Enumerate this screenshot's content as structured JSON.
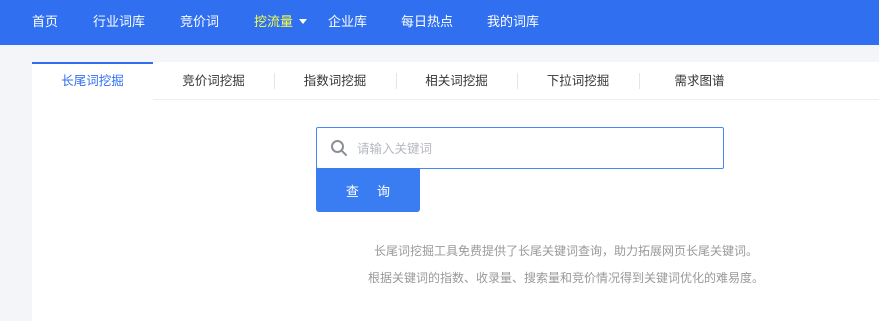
{
  "topnav": {
    "items": [
      {
        "label": "首页"
      },
      {
        "label": "行业词库"
      },
      {
        "label": "竞价词"
      },
      {
        "label": "挖流量"
      },
      {
        "label": "企业库"
      },
      {
        "label": "每日热点"
      },
      {
        "label": "我的词库"
      }
    ],
    "active_index": 3
  },
  "tabs": [
    {
      "label": "长尾词挖掘"
    },
    {
      "label": "竞价词挖掘"
    },
    {
      "label": "指数词挖掘"
    },
    {
      "label": "相关词挖掘"
    },
    {
      "label": "下拉词挖掘"
    },
    {
      "label": "需求图谱"
    }
  ],
  "active_tab_index": 0,
  "search": {
    "placeholder": "请输入关键词",
    "value": "",
    "button_label": "查 询"
  },
  "description": [
    "长尾词挖掘工具免费提供了长尾关键词查询，助力拓展网页长尾关键词。",
    "根据关键词的指数、收录量、搜索量和竞价情况得到关键词优化的难易度。"
  ],
  "colors": {
    "nav_bg": "#2f6ff0",
    "nav_active": "#f6ff4a",
    "accent": "#2f6ff0",
    "button_bg": "#3a7df2",
    "page_bg": "#f4f5f9"
  }
}
